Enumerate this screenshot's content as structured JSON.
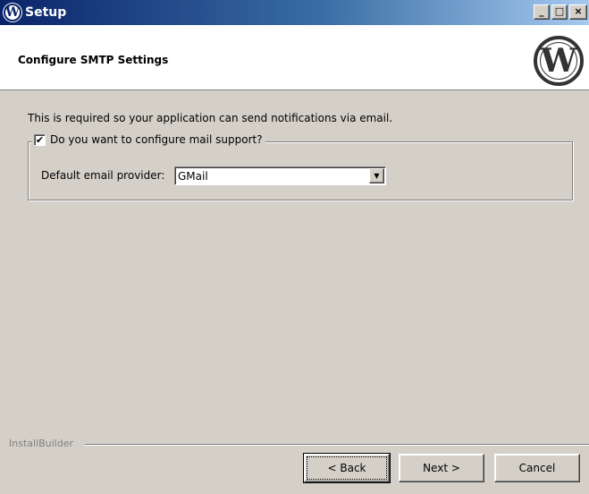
{
  "window": {
    "title": "Setup",
    "logo_glyph": "W",
    "minimize_glyph": "_",
    "maximize_glyph": "□",
    "close_glyph": "×"
  },
  "header": {
    "title": "Configure SMTP Settings",
    "logo_glyph": "W"
  },
  "content": {
    "description": "This is required so your application can send notifications via email.",
    "mail_support": {
      "label": "Do you want to configure mail support?",
      "checked": true,
      "check_glyph": "✔"
    },
    "provider": {
      "label": "Default email provider:",
      "value": "GMail",
      "arrow_glyph": "▼"
    }
  },
  "footer": {
    "brand": "InstallBuilder",
    "back_label": "< Back",
    "next_label": "Next >",
    "cancel_label": "Cancel"
  }
}
